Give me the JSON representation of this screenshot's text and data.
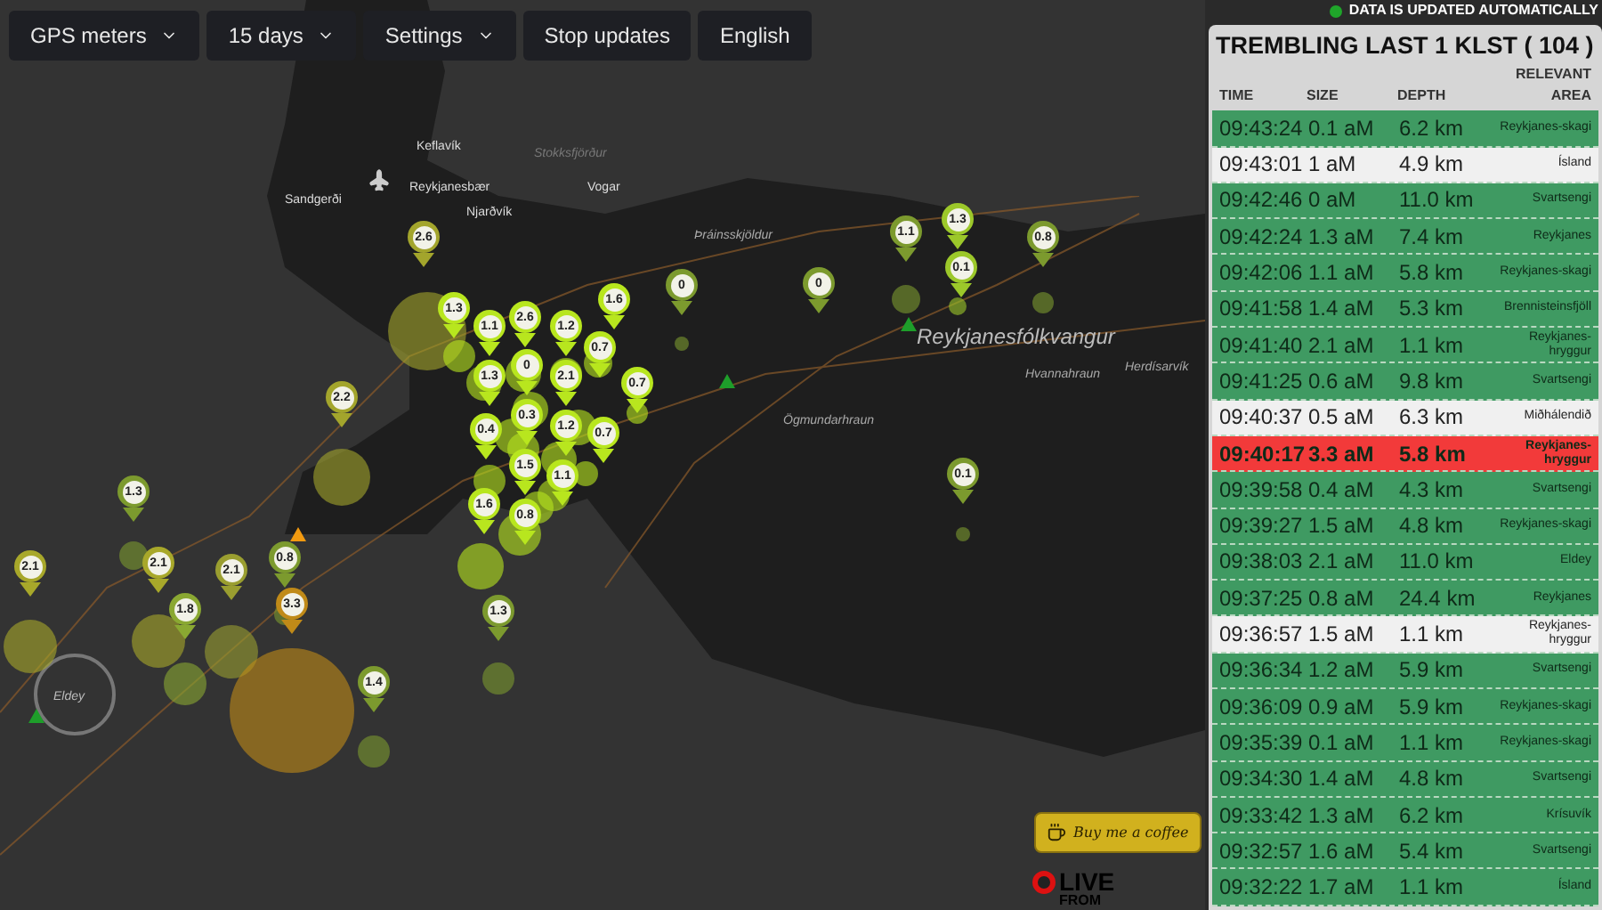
{
  "toolbar": [
    {
      "label": "GPS meters",
      "kind": "dropdown"
    },
    {
      "label": "15 days",
      "kind": "dropdown"
    },
    {
      "label": "Settings",
      "kind": "dropdown"
    },
    {
      "label": "Stop updates",
      "kind": "button"
    },
    {
      "label": "English",
      "kind": "button"
    }
  ],
  "map": {
    "places": [
      {
        "name": "Sandgerði",
        "kind": "town"
      },
      {
        "name": "Keflavík",
        "kind": "town"
      },
      {
        "name": "Stokksfjörður",
        "kind": "water"
      },
      {
        "name": "Reykjanesbær",
        "kind": "town"
      },
      {
        "name": "Vogar",
        "kind": "town"
      },
      {
        "name": "Njarðvík",
        "kind": "town"
      },
      {
        "name": "Þráinsskjöldur",
        "kind": "area"
      },
      {
        "name": "Reykjanesfólkvangur",
        "kind": "park"
      },
      {
        "name": "Hvannahraun",
        "kind": "area"
      },
      {
        "name": "Herdísarvík",
        "kind": "area"
      },
      {
        "name": "Ögmundarhraun",
        "kind": "area"
      },
      {
        "name": "Eldey",
        "kind": "island"
      }
    ],
    "markers": [
      {
        "value": "2.6",
        "color": "#a3a52c"
      },
      {
        "value": "2.2",
        "color": "#a3a52c"
      },
      {
        "value": "1.3",
        "color": "#7c9a2e"
      },
      {
        "value": "2.1",
        "color": "#a8a82a"
      },
      {
        "value": "2.1",
        "color": "#a8a82a"
      },
      {
        "value": "1.8",
        "color": "#8aa832"
      },
      {
        "value": "2.1",
        "color": "#9a9e30"
      },
      {
        "value": "0.8",
        "color": "#7c9a2e"
      },
      {
        "value": "3.3",
        "color": "#c08a18"
      },
      {
        "value": "1.4",
        "color": "#7c9a2e"
      },
      {
        "value": "1.3",
        "color": "#7c9a2e"
      },
      {
        "value": "0.1",
        "color": "#7c9a2e"
      },
      {
        "value": "0",
        "color": "#7c9a2e"
      },
      {
        "value": "0",
        "color": "#7c9a2e"
      },
      {
        "value": "1.1",
        "color": "#7c9a2e"
      },
      {
        "value": "1.3",
        "color": "#9cc82a"
      },
      {
        "value": "0.1",
        "color": "#9cc82a"
      },
      {
        "value": "0.8",
        "color": "#7c9a2e"
      },
      {
        "value": "1.6",
        "color": "#b8e61e"
      },
      {
        "value": "1.3",
        "color": "#b8e61e"
      },
      {
        "value": "1.1",
        "color": "#b8e61e"
      },
      {
        "value": "2.6",
        "color": "#b8e61e"
      },
      {
        "value": "1.2",
        "color": "#b8e61e"
      },
      {
        "value": "0.7",
        "color": "#b8e61e"
      },
      {
        "value": "0",
        "color": "#b8e61e"
      },
      {
        "value": "2.1",
        "color": "#b8e61e"
      },
      {
        "value": "1.3",
        "color": "#b8e61e"
      },
      {
        "value": "0.3",
        "color": "#b8e61e"
      },
      {
        "value": "1.2",
        "color": "#b8e61e"
      },
      {
        "value": "0.7",
        "color": "#b8e61e"
      },
      {
        "value": "0.7",
        "color": "#b8e61e"
      },
      {
        "value": "0.4",
        "color": "#b8e61e"
      },
      {
        "value": "1.1",
        "color": "#b8e61e"
      },
      {
        "value": "1.5",
        "color": "#b8e61e"
      },
      {
        "value": "0.8",
        "color": "#b8e61e"
      },
      {
        "value": "1.6",
        "color": "#b8e61e"
      }
    ]
  },
  "coffee_button": {
    "label": "Buy me a coffee"
  },
  "logo": {
    "line_1": "LIVE",
    "line_2": "FROM"
  },
  "status": {
    "text": "DATA IS UPDATED AUTOMATICALLY",
    "live": true
  },
  "quakes": {
    "title": "TREMBLING LAST 1 KLST ( 104 )",
    "columns": [
      "TIME",
      "SIZE",
      "DEPTH",
      "RELEVANT AREA"
    ],
    "rows": [
      {
        "time": "09:43:24",
        "size": "0.1 aM",
        "depth": "6.2 km",
        "area": "Reykjanes-skagi",
        "color": "#3f9a62"
      },
      {
        "time": "09:43:01",
        "size": "1 aM",
        "depth": "4.9 km",
        "area": "Ísland",
        "color": "#f0f0f0"
      },
      {
        "time": "09:42:46",
        "size": "0 aM",
        "depth": "11.0 km",
        "area": "Svartsengi",
        "color": "#3f9a62"
      },
      {
        "time": "09:42:24",
        "size": "1.3 aM",
        "depth": "7.4 km",
        "area": "Reykjanes",
        "color": "#3f9a62"
      },
      {
        "time": "09:42:06",
        "size": "1.1 aM",
        "depth": "5.8 km",
        "area": "Reykjanes-skagi",
        "color": "#3f9a62"
      },
      {
        "time": "09:41:58",
        "size": "1.4 aM",
        "depth": "5.3 km",
        "area": "Brennisteinsfjöll",
        "color": "#3f9a62"
      },
      {
        "time": "09:41:40",
        "size": "2.1 aM",
        "depth": "1.1 km",
        "area": "Reykjanes-hryggur",
        "color": "#3f9a62"
      },
      {
        "time": "09:41:25",
        "size": "0.6 aM",
        "depth": "9.8 km",
        "area": "Svartsengi",
        "color": "#3f9a62"
      },
      {
        "time": "09:40:37",
        "size": "0.5 aM",
        "depth": "6.3 km",
        "area": "Miðhálendið",
        "color": "#f0f0f0"
      },
      {
        "time": "09:40:17",
        "size": "3.3 aM",
        "depth": "5.8 km",
        "area": "Reykjanes-hryggur",
        "color": "#f23a3a"
      },
      {
        "time": "09:39:58",
        "size": "0.4 aM",
        "depth": "4.3 km",
        "area": "Svartsengi",
        "color": "#3f9a62"
      },
      {
        "time": "09:39:27",
        "size": "1.5 aM",
        "depth": "4.8 km",
        "area": "Reykjanes-skagi",
        "color": "#3f9a62"
      },
      {
        "time": "09:38:03",
        "size": "2.1 aM",
        "depth": "11.0 km",
        "area": "Eldey",
        "color": "#3f9a62"
      },
      {
        "time": "09:37:25",
        "size": "0.8 aM",
        "depth": "24.4 km",
        "area": "Reykjanes",
        "color": "#3f9a62"
      },
      {
        "time": "09:36:57",
        "size": "1.5 aM",
        "depth": "1.1 km",
        "area": "Reykjanes-hryggur",
        "color": "#f0f0f0"
      },
      {
        "time": "09:36:34",
        "size": "1.2 aM",
        "depth": "5.9 km",
        "area": "Svartsengi",
        "color": "#3f9a62"
      },
      {
        "time": "09:36:09",
        "size": "0.9 aM",
        "depth": "5.9 km",
        "area": "Reykjanes-skagi",
        "color": "#3f9a62"
      },
      {
        "time": "09:35:39",
        "size": "0.1 aM",
        "depth": "1.1 km",
        "area": "Reykjanes-skagi",
        "color": "#3f9a62"
      },
      {
        "time": "09:34:30",
        "size": "1.4 aM",
        "depth": "4.8 km",
        "area": "Svartsengi",
        "color": "#3f9a62"
      },
      {
        "time": "09:33:42",
        "size": "1.3 aM",
        "depth": "6.2 km",
        "area": "Krísuvík",
        "color": "#3f9a62"
      },
      {
        "time": "09:32:57",
        "size": "1.6 aM",
        "depth": "5.4 km",
        "area": "Svartsengi",
        "color": "#3f9a62"
      },
      {
        "time": "09:32:22",
        "size": "1.7 aM",
        "depth": "1.1 km",
        "area": "Ísland",
        "color": "#3f9a62"
      }
    ]
  }
}
